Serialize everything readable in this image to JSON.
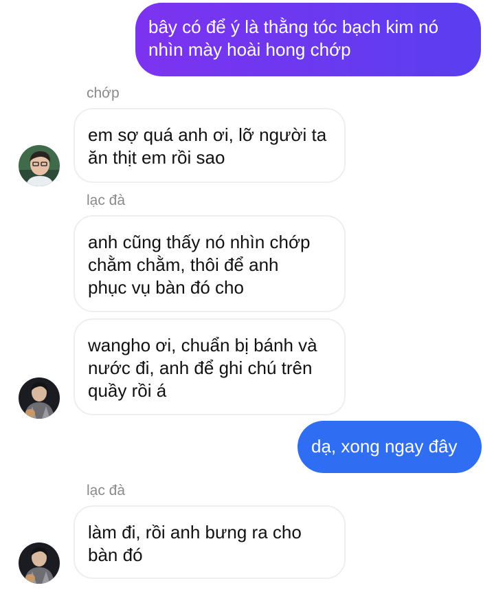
{
  "conversation": {
    "colors": {
      "outgoing_gradient_start": "#7d33f0",
      "outgoing_gradient_end": "#5a3ef0",
      "outgoing_solid": "#2f6df2",
      "incoming_border": "#eeeeee",
      "sender_name": "#8a8a8a"
    },
    "messages": [
      {
        "direction": "outgoing",
        "text": "bây có để ý là thằng tóc bạch kim nó\nnhìn mày hoài hong chớp"
      },
      {
        "direction": "incoming",
        "sender": "chớp",
        "avatar": "avatar-chop",
        "text": "em sợ quá anh ơi, lỡ người ta\năn thịt em rồi sao"
      },
      {
        "direction": "incoming",
        "sender": "lạc đà",
        "text": "anh cũng thấy nó nhìn chớp\nchằm chằm, thôi để anh\nphục vụ bàn đó cho"
      },
      {
        "direction": "incoming",
        "avatar": "avatar-lac-da",
        "text": "wangho ơi, chuẩn bị bánh và\nnước đi, anh để ghi chú trên\nquầy rồi á"
      },
      {
        "direction": "outgoing",
        "text": "dạ, xong ngay đây"
      },
      {
        "direction": "incoming",
        "sender": "lạc đà",
        "avatar": "avatar-lac-da",
        "text": "làm đi, rồi anh bưng ra cho\nbàn đó"
      }
    ]
  }
}
